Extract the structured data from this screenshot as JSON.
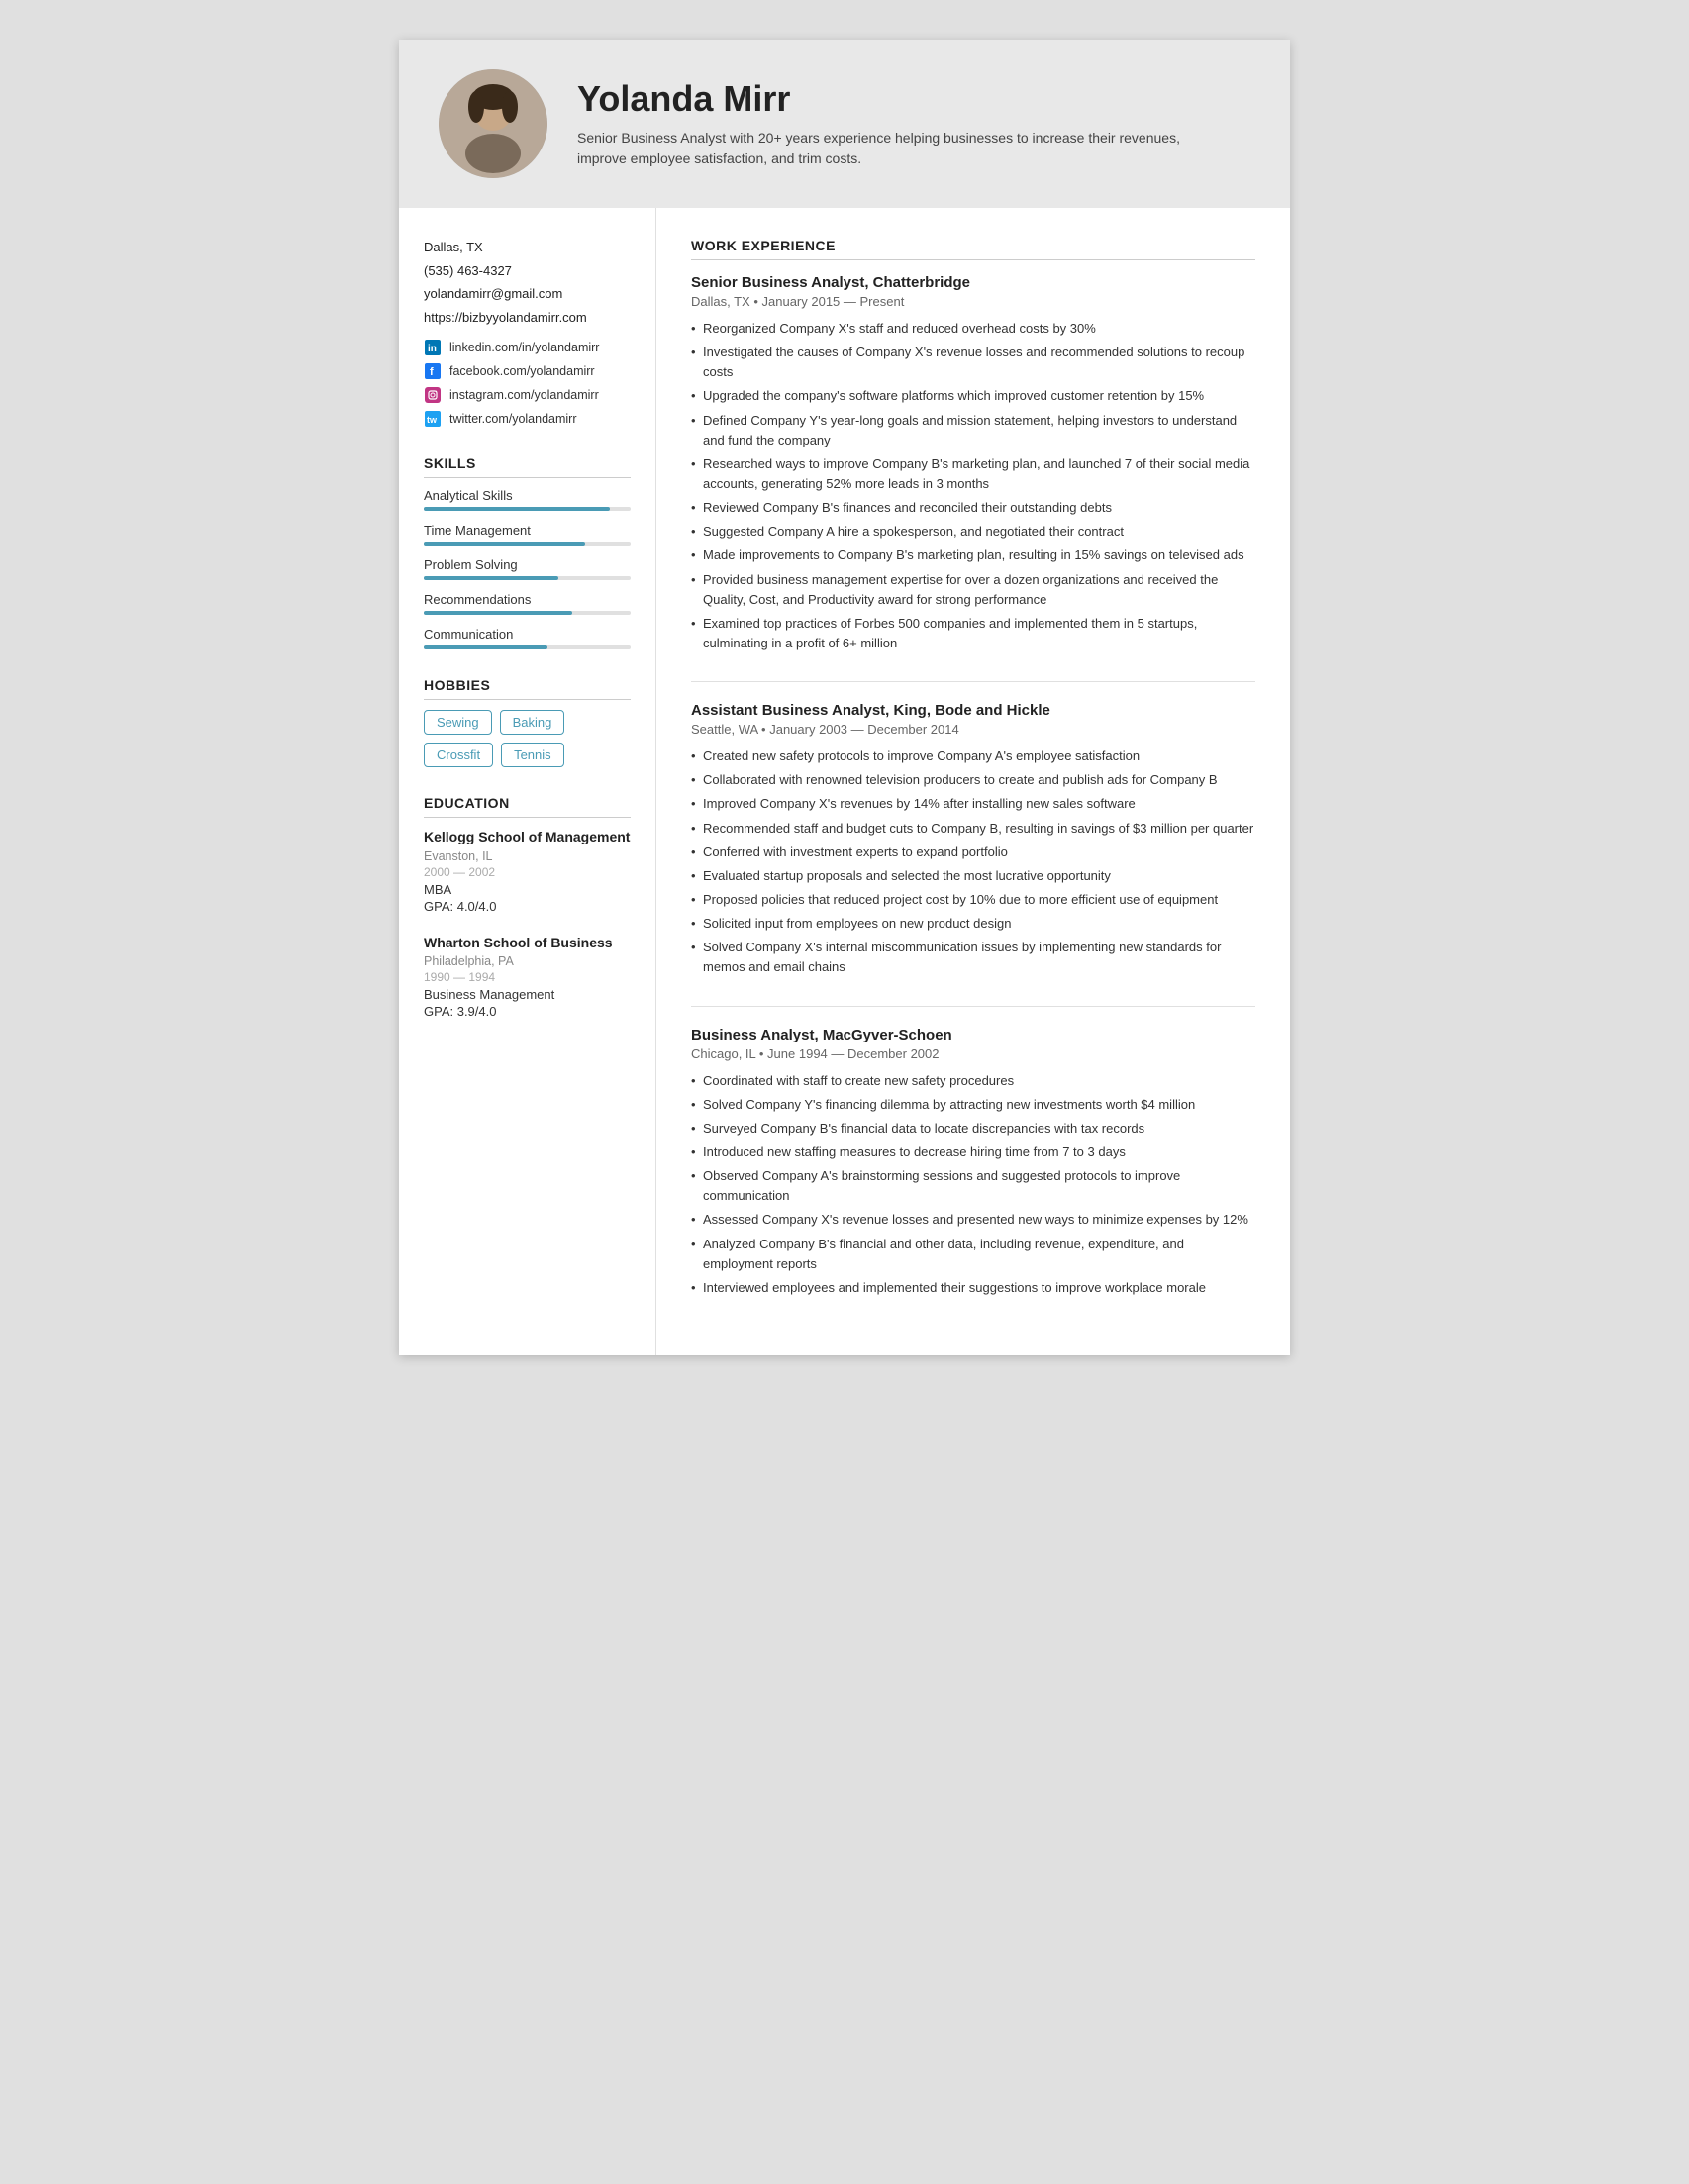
{
  "header": {
    "name": "Yolanda Mirr",
    "summary": "Senior Business Analyst with 20+ years experience helping businesses to increase their revenues, improve employee satisfaction, and trim costs."
  },
  "sidebar": {
    "contact": {
      "location": "Dallas, TX",
      "phone": "(535) 463-4327",
      "email": "yolandamirr@gmail.com",
      "website": "https://bizbyyolandamirr.com"
    },
    "social": [
      {
        "platform": "linkedin",
        "handle": "linkedin.com/in/yolandamirr"
      },
      {
        "platform": "facebook",
        "handle": "facebook.com/yolandamirr"
      },
      {
        "platform": "instagram",
        "handle": "instagram.com/yolandamirr"
      },
      {
        "platform": "twitter",
        "handle": "twitter.com/yolandamirr"
      }
    ],
    "skills_title": "SKILLS",
    "skills": [
      {
        "name": "Analytical Skills",
        "pct": 90
      },
      {
        "name": "Time Management",
        "pct": 78
      },
      {
        "name": "Problem Solving",
        "pct": 65
      },
      {
        "name": "Recommendations",
        "pct": 72
      },
      {
        "name": "Communication",
        "pct": 60
      }
    ],
    "hobbies_title": "HOBBIES",
    "hobbies": [
      "Sewing",
      "Baking",
      "Crossfit",
      "Tennis"
    ],
    "education_title": "EDUCATION",
    "education": [
      {
        "school": "Kellogg School of Management",
        "location": "Evanston, IL",
        "years": "2000 — 2002",
        "degree": "MBA",
        "gpa": "GPA: 4.0/4.0"
      },
      {
        "school": "Wharton School of Business",
        "location": "Philadelphia, PA",
        "years": "1990 — 1994",
        "degree": "Business Management",
        "gpa": "GPA: 3.9/4.0"
      }
    ]
  },
  "main": {
    "work_title": "WORK EXPERIENCE",
    "jobs": [
      {
        "title": "Senior Business Analyst, Chatterbridge",
        "meta": "Dallas, TX • January 2015 — Present",
        "bullets": [
          "Reorganized Company X's staff and reduced overhead costs by 30%",
          "Investigated the causes of Company X's revenue losses and recommended solutions to recoup costs",
          "Upgraded the company's software platforms which improved customer retention by 15%",
          "Defined Company Y's year-long goals and mission statement, helping investors to understand and fund the company",
          "Researched ways to improve Company B's marketing plan, and launched 7 of their social media accounts, generating 52% more leads in 3 months",
          "Reviewed Company B's finances and reconciled their outstanding debts",
          "Suggested Company A hire a spokesperson, and negotiated their contract",
          "Made improvements to Company B's marketing plan, resulting in 15% savings on televised ads",
          "Provided business management expertise for over a dozen organizations and received the Quality, Cost, and Productivity award for strong performance",
          "Examined top practices of Forbes 500 companies and implemented them in 5 startups, culminating in a profit of 6+ million"
        ]
      },
      {
        "title": "Assistant Business Analyst, King, Bode and Hickle",
        "meta": "Seattle, WA • January 2003 — December 2014",
        "bullets": [
          "Created new safety protocols to improve Company A's employee satisfaction",
          "Collaborated with renowned television producers to create and publish ads for Company B",
          "Improved Company X's revenues by 14% after installing new sales software",
          "Recommended staff and budget cuts to Company B, resulting in savings of $3 million per quarter",
          "Conferred with investment experts to expand portfolio",
          "Evaluated startup proposals and selected the most lucrative opportunity",
          "Proposed policies that reduced project cost by 10% due to more efficient use of equipment",
          "Solicited input from employees on new product design",
          "Solved Company X's internal miscommunication issues by implementing new standards for memos and email chains"
        ]
      },
      {
        "title": "Business Analyst, MacGyver-Schoen",
        "meta": "Chicago, IL • June 1994 — December 2002",
        "bullets": [
          "Coordinated with staff to create new safety procedures",
          "Solved Company Y's financing dilemma by attracting new investments worth $4 million",
          "Surveyed Company B's financial data to locate discrepancies with tax records",
          "Introduced new staffing measures to decrease hiring time from 7 to 3 days",
          "Observed Company A's brainstorming sessions and suggested protocols to improve communication",
          "Assessed Company X's revenue losses and presented new ways to minimize expenses by 12%",
          "Analyzed Company B's financial and other data, including revenue, expenditure, and employment reports",
          "Interviewed employees and implemented their suggestions to improve workplace morale"
        ]
      }
    ]
  }
}
